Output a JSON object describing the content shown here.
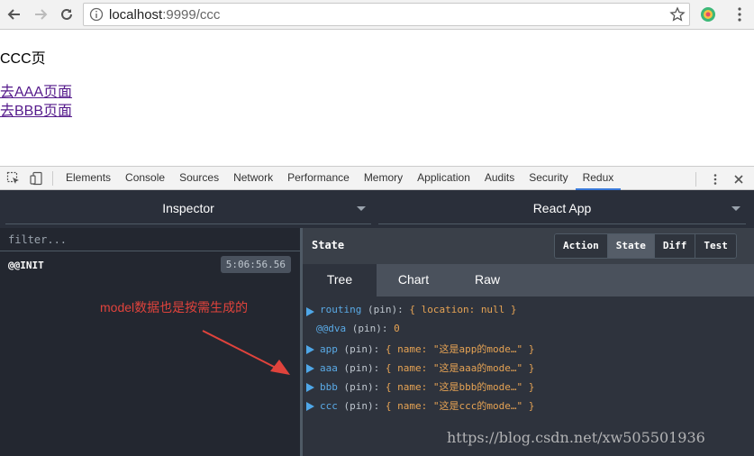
{
  "browser": {
    "url_host": "localhost",
    "url_rest": ":9999/ccc"
  },
  "page": {
    "title": "CCC页",
    "links": [
      "去AAA页面",
      "去BBB页面"
    ]
  },
  "devtools": {
    "tabs": [
      "Elements",
      "Console",
      "Sources",
      "Network",
      "Performance",
      "Memory",
      "Application",
      "Audits",
      "Security",
      "Redux"
    ],
    "active_tab": "Redux"
  },
  "redux": {
    "left_selector": "Inspector",
    "right_selector": "React App",
    "filter_placeholder": "filter...",
    "actions": [
      {
        "name": "@@INIT",
        "time": "5:06:56.56"
      }
    ],
    "state_title": "State",
    "mode_buttons": [
      "Action",
      "State",
      "Diff",
      "Test"
    ],
    "active_mode": "State",
    "sub_tabs": [
      "Tree",
      "Chart",
      "Raw"
    ],
    "active_sub_tab": "Tree",
    "tree": [
      {
        "key": "routing",
        "meta": " (pin): ",
        "val": "{ location: null }",
        "expandable": true
      },
      {
        "key": "@@dva",
        "meta": " (pin): ",
        "val": "0",
        "expandable": false
      },
      {
        "key": "app",
        "meta": " (pin): ",
        "val": "{ name: \"这是app的mode…\" }",
        "expandable": true
      },
      {
        "key": "aaa",
        "meta": " (pin): ",
        "val": "{ name: \"这是aaa的mode…\" }",
        "expandable": true
      },
      {
        "key": "bbb",
        "meta": " (pin): ",
        "val": "{ name: \"这是bbb的mode…\" }",
        "expandable": true
      },
      {
        "key": "ccc",
        "meta": " (pin): ",
        "val": "{ name: \"这是ccc的mode…\" }",
        "expandable": true
      }
    ]
  },
  "annotation": {
    "text": "model数据也是按需生成的"
  },
  "watermark": "https://blog.csdn.net/xw505501936",
  "colors": {
    "accent_blue": "#3879d9",
    "annotation_red": "#e0433c",
    "tree_key": "#5aaae6",
    "tree_value": "#e6a354"
  }
}
